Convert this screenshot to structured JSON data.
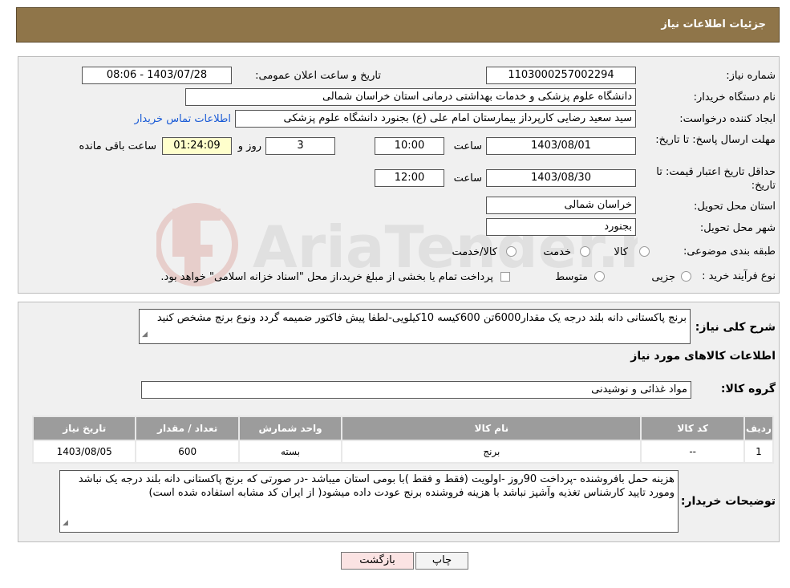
{
  "header": {
    "title": "جزئیات اطلاعات نیاز"
  },
  "fields": {
    "need_number_label": "شماره نیاز:",
    "need_number": "1103000257002294",
    "announce_label": "تاریخ و ساعت اعلان عمومی:",
    "announce_value": "1403/07/28 - 08:06",
    "buyer_org_label": "نام دستگاه خریدار:",
    "buyer_org": "دانشگاه علوم پزشکی و خدمات بهداشتی درمانی استان خراسان شمالی",
    "requester_label": "ایجاد کننده درخواست:",
    "requester": "سید سعید رضایی کارپرداز بیمارستان امام علی (ع) بجنورد دانشگاه علوم پزشکی",
    "contact_link": "اطلاعات تماس خریدار",
    "deadline_label": "مهلت ارسال پاسخ: تا تاریخ:",
    "deadline_date": "1403/08/01",
    "time_label": "ساعت",
    "deadline_time": "10:00",
    "days_value": "3",
    "days_label": "روز و",
    "remaining_time": "01:24:09",
    "remaining_label": "ساعت باقی مانده",
    "validity_label": "حداقل تاریخ اعتبار قیمت: تا تاریخ:",
    "validity_date": "1403/08/30",
    "validity_time": "12:00",
    "province_label": "استان محل تحویل:",
    "province": "خراسان شمالی",
    "city_label": "شهر محل تحویل:",
    "city": "بجنورد",
    "category_label": "طبقه بندی موضوعی:",
    "category_options": [
      "کالا",
      "خدمت",
      "کالا/خدمت"
    ],
    "process_label": "نوع فرآیند خرید :",
    "process_options": [
      "جزیی",
      "متوسط"
    ],
    "process_note": "پرداخت تمام یا بخشی از مبلغ خرید،از محل \"اسناد خزانه اسلامی\" خواهد بود."
  },
  "summary": {
    "label": "شرح کلی نیاز:",
    "text": "برنج پاکستانی دانه بلند درجه یک مقدار6000تن 600کیسه 10کیلویی-لطفا پیش فاکتور ضمیمه گردد ونوع برنج مشخص کنید",
    "items_title": "اطلاعات کالاهای مورد نیاز",
    "group_label": "گروه کالا:",
    "group_value": "مواد غذائی و نوشیدنی"
  },
  "table": {
    "headers": [
      "ردیف",
      "کد کالا",
      "نام کالا",
      "واحد شمارش",
      "تعداد / مقدار",
      "تاریخ نیاز"
    ],
    "rows": [
      [
        "1",
        "--",
        "برنج",
        "بسته",
        "600",
        "1403/08/05"
      ]
    ]
  },
  "notes": {
    "label": "توضیحات خریدار:",
    "text": "هزینه حمل بافروشنده  -پرداخت 90روز -اولویت (فقط و فقط )با بومی استان میباشد -در صورتی که برنج پاکستانی دانه بلند درجه یک نباشد ومورد تایید کارشناس تغذیه وآشپز نباشد با هزینه فروشنده برنج عودت داده میشود( از ایران کد مشابه استفاده شده است)"
  },
  "buttons": {
    "print": "چاپ",
    "back": "بازگشت"
  },
  "watermark": {
    "text": "AriaTender.neT"
  },
  "colors": {
    "header_bg": "#8f7549",
    "table_header_bg": "#9c9c9c",
    "link": "#1a5bd6",
    "back_btn_bg": "#fbe3e3"
  }
}
